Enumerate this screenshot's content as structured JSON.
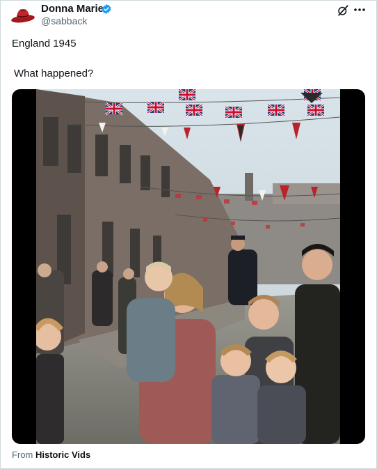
{
  "author": {
    "display_name": "Donna Marie",
    "handle": "@sabback",
    "avatar_icon": "cowboy-hat-icon",
    "verified_icon": "verified-badge-icon"
  },
  "actions": {
    "grok_icon": "grok-icon",
    "more_icon": "more-options-icon"
  },
  "post": {
    "line1": "England 1945",
    "line2": "What happened?"
  },
  "media": {
    "type": "video",
    "scene": "street-party-with-union-flag-bunting"
  },
  "attribution": {
    "prefix": "From",
    "source": "Historic Vids"
  },
  "colors": {
    "text_primary": "#0f1419",
    "text_secondary": "#536471",
    "verified_blue": "#1d9bf0",
    "border": "#cfd9de"
  }
}
